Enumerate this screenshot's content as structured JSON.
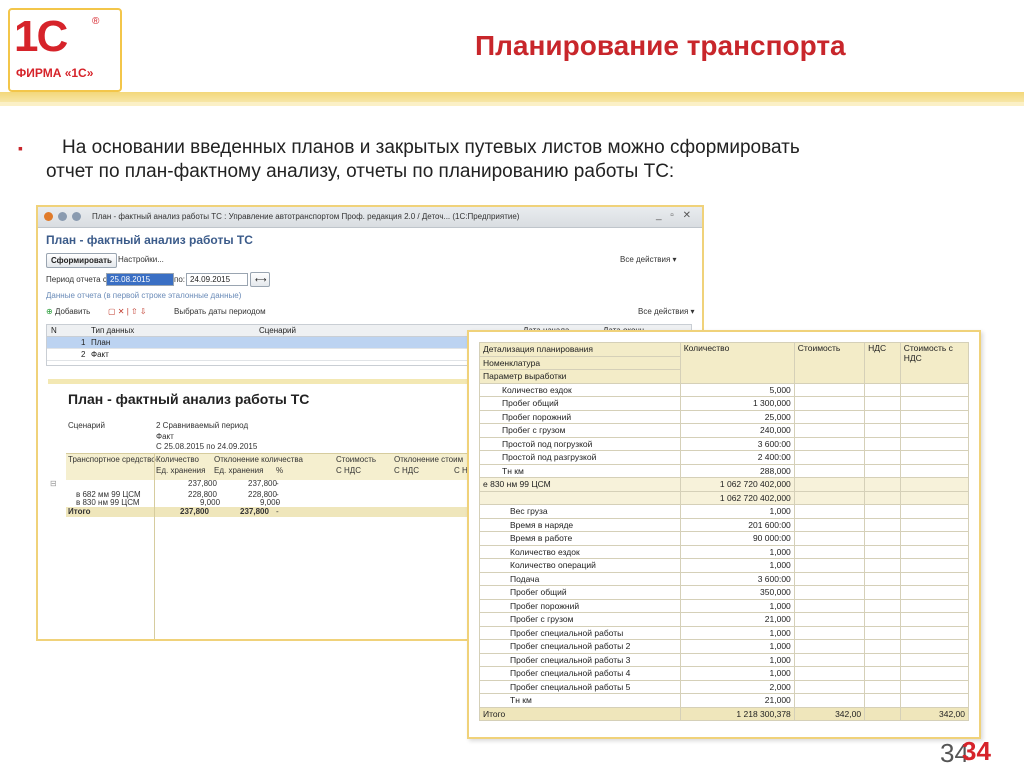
{
  "header": {
    "logo_main": "1С",
    "logo_reg": "®",
    "logo_sub": "ФИРМА «1С»",
    "title": "Планирование транспорта"
  },
  "bullet": {
    "marker": "▪",
    "line1": "На основании введенных планов и закрытых путевых листов можно сформировать",
    "line2": "отчет по план-фактному анализу, отчеты по планированию работы ТС:"
  },
  "window1": {
    "titlebar": "План - фактный анализ работы ТС : Управление автотранспортом Проф. редакция 2.0 / Деточ... (1С:Предприятие)",
    "controls": "_ ▫ ✕",
    "heading": "План - фактный анализ работы ТС",
    "form_button": "Сформировать",
    "settings_button": "Настройки...",
    "all_actions": "Все действия ▾",
    "period_label": "Период отчета с:",
    "period_from": "25.08.2015",
    "period_to_label": "по:",
    "period_to": "24.09.2015",
    "data_hint": "Данные отчета (в первой строке эталонные данные)",
    "add_button": "Добавить",
    "select_dates": "Выбрать даты периодом",
    "all_actions2": "Все действия ▾",
    "grid_headers": [
      "N",
      "Тип данных",
      "Сценарий",
      "Дата начала",
      "Дата оконч..."
    ],
    "grid_rows": [
      {
        "n": "1",
        "type": "План"
      },
      {
        "n": "2",
        "type": "Факт"
      }
    ],
    "report": {
      "title": "План - фактный анализ работы ТС",
      "scenario_label": "Сценарий",
      "scenario_value": "2  Сравниваемый период",
      "fact": "Факт",
      "dates": "С 25.08.2015 по 24.09.2015",
      "col_vehicle": "Транспортное средство",
      "col_qty": "Количество",
      "col_qty_unit": "Ед. хранения",
      "col_dev_qty": "Отклонение количества",
      "col_dev_unit": "Ед. хранения",
      "col_pct": "%",
      "col_cost": "Стоимость",
      "col_cost_vat": "С НДС",
      "col_dev_cost": "Отклонение стоим",
      "col_dev_cost_vat": "С НДС",
      "col_extra": "С Н",
      "rows": [
        {
          "name": "",
          "qty": "237,800",
          "dev": "237,800",
          "pct": "-"
        },
        {
          "name": "в 682 мм 99 ЦСМ",
          "qty": "228,800",
          "dev": "228,800",
          "pct": "-"
        },
        {
          "name": "в 830 нм 99 ЦСМ",
          "qty": "9,000",
          "dev": "9,000",
          "pct": "-"
        }
      ],
      "total_label": "Итого",
      "total_qty": "237,800",
      "total_dev": "237,800",
      "total_pct": "-"
    }
  },
  "window2": {
    "headers": {
      "detail": "Детализация планирования",
      "nomenclature": "Номенклатура",
      "parameter": "Параметр выработки",
      "qty": "Количество",
      "cost": "Стоимость",
      "vat": "НДС",
      "cost_vat": "Стоимость с НДС"
    },
    "rows": [
      {
        "name": "Количество ездок",
        "qty": "5,000",
        "lvl": 1
      },
      {
        "name": "Пробег общий",
        "qty": "1 300,000",
        "lvl": 1
      },
      {
        "name": "Пробег порожний",
        "qty": "25,000",
        "lvl": 1
      },
      {
        "name": "Пробег с грузом",
        "qty": "240,000",
        "lvl": 1
      },
      {
        "name": "Простой под погрузкой",
        "qty": "3 600:00",
        "lvl": 1
      },
      {
        "name": "Простой под разгрузкой",
        "qty": "2 400:00",
        "lvl": 1
      },
      {
        "name": "Тн км",
        "qty": "288,000",
        "lvl": 1
      },
      {
        "name": "е 830 нм 99 ЦСМ",
        "qty": "1 062 720 402,000",
        "lvl": 0
      },
      {
        "name": "",
        "qty": "1 062 720 402,000",
        "lvl": 0
      },
      {
        "name": "Вес груза",
        "qty": "1,000",
        "lvl": 2
      },
      {
        "name": "Время в наряде",
        "qty": "201 600:00",
        "lvl": 2
      },
      {
        "name": "Время в работе",
        "qty": "90 000:00",
        "lvl": 2
      },
      {
        "name": "Количество ездок",
        "qty": "1,000",
        "lvl": 2
      },
      {
        "name": "Количество операций",
        "qty": "1,000",
        "lvl": 2
      },
      {
        "name": "Подача",
        "qty": "3 600:00",
        "lvl": 2
      },
      {
        "name": "Пробег общий",
        "qty": "350,000",
        "lvl": 2
      },
      {
        "name": "Пробег порожний",
        "qty": "1,000",
        "lvl": 2
      },
      {
        "name": "Пробег с грузом",
        "qty": "21,000",
        "lvl": 2
      },
      {
        "name": "Пробег специальной работы",
        "qty": "1,000",
        "lvl": 2
      },
      {
        "name": "Пробег специальной работы 2",
        "qty": "1,000",
        "lvl": 2
      },
      {
        "name": "Пробег специальной работы 3",
        "qty": "1,000",
        "lvl": 2
      },
      {
        "name": "Пробег специальной работы 4",
        "qty": "1,000",
        "lvl": 2
      },
      {
        "name": "Пробег специальной работы 5",
        "qty": "2,000",
        "lvl": 2
      },
      {
        "name": "Тн км",
        "qty": "21,000",
        "lvl": 2
      }
    ],
    "total": {
      "label": "Итого",
      "qty": "1 218 300,378",
      "cost": "342,00",
      "cost_vat": "342,00"
    }
  },
  "page": {
    "num_shadow": "34",
    "num": "34"
  }
}
